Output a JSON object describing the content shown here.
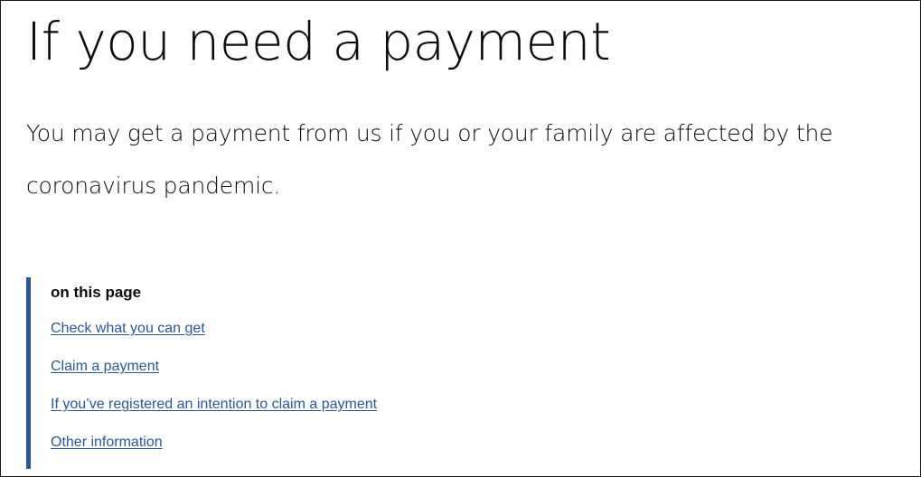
{
  "page": {
    "title": "If you need a payment",
    "lede": "You may get a payment from us if you or your family are affected by the coronavirus pandemic."
  },
  "toc": {
    "heading": "on this page",
    "links": [
      {
        "label": "Check what you can get"
      },
      {
        "label": "Claim a payment"
      },
      {
        "label": "If you’ve registered an intention to claim a payment"
      },
      {
        "label": "Other information"
      }
    ],
    "accent_color": "#2b5797"
  }
}
